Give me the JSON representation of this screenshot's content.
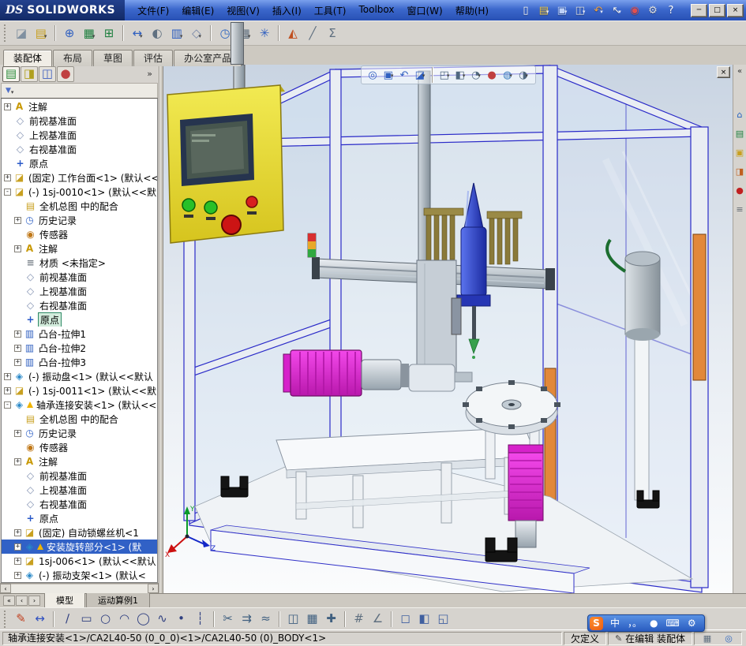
{
  "ui": {
    "dropdown_glyph": "▾"
  },
  "app": {
    "title_prefix": "DS",
    "title": "SOLIDWORKS"
  },
  "menubar": {
    "items": [
      "文件(F)",
      "编辑(E)",
      "视图(V)",
      "插入(I)",
      "工具(T)",
      "Toolbox",
      "窗口(W)",
      "帮助(H)"
    ]
  },
  "titlebar_tools": [
    {
      "name": "new-document-icon",
      "glyph": "▯",
      "color": "#f8f8f8"
    },
    {
      "name": "open-icon",
      "glyph": "▤",
      "color": "#f0c840",
      "dd": 1
    },
    {
      "name": "save-icon",
      "glyph": "▣",
      "color": "#bcd0f8",
      "dd": 1
    },
    {
      "name": "print-icon",
      "glyph": "◫",
      "color": "#d8dce0",
      "dd": 1
    },
    {
      "name": "undo-icon",
      "glyph": "↶",
      "color": "#f0a040",
      "dd": 1
    },
    {
      "name": "select-icon",
      "glyph": "↖",
      "color": "#f0f0f0",
      "dd": 1
    },
    {
      "name": "rebuild-icon",
      "glyph": "◉",
      "color": "#e05050"
    },
    {
      "name": "options-icon",
      "glyph": "⚙",
      "color": "#e0e0e0"
    },
    {
      "name": "help-icon",
      "glyph": "?",
      "color": "#ffffff"
    }
  ],
  "window_controls": [
    {
      "name": "minimize-button",
      "glyph": "─"
    },
    {
      "name": "maximize-button",
      "glyph": "□"
    },
    {
      "name": "close-button",
      "glyph": "×"
    }
  ],
  "toolbar2": {
    "items": [
      {
        "name": "edit-component-icon",
        "glyph": "◪",
        "color": "#8090a0"
      },
      {
        "name": "insert-components-icon",
        "glyph": "▤",
        "color": "#c8a020",
        "dd": 1
      },
      {
        "sep": 1
      },
      {
        "name": "mate-icon",
        "glyph": "⊕",
        "color": "#3060c0"
      },
      {
        "name": "linear-component-pattern-icon",
        "glyph": "▦",
        "color": "#208040",
        "dd": 1
      },
      {
        "name": "smart-fasteners-icon",
        "glyph": "⊞",
        "color": "#208040"
      },
      {
        "sep": 1
      },
      {
        "name": "move-component-icon",
        "glyph": "↔",
        "color": "#3060c0",
        "dd": 1
      },
      {
        "name": "show-hidden-components-icon",
        "glyph": "◐",
        "color": "#607080"
      },
      {
        "name": "assembly-features-icon",
        "glyph": "▥",
        "color": "#3060c0",
        "dd": 1
      },
      {
        "name": "reference-geometry-icon",
        "glyph": "◇",
        "color": "#7888a8",
        "dd": 1
      },
      {
        "sep": 1
      },
      {
        "name": "new-motion-study-icon",
        "glyph": "◷",
        "color": "#3068c0"
      },
      {
        "name": "bill-of-materials-icon",
        "glyph": "▦",
        "color": "#607080",
        "dd": 1
      },
      {
        "name": "exploded-view-icon",
        "glyph": "✳",
        "color": "#3060c0"
      },
      {
        "sep": 1
      },
      {
        "name": "interference-detection-icon",
        "glyph": "◭",
        "color": "#c05020"
      },
      {
        "name": "measure-icon",
        "glyph": "╱",
        "color": "#607080"
      },
      {
        "name": "mass-properties-icon",
        "glyph": "Σ",
        "color": "#607080"
      }
    ]
  },
  "command_tabs": {
    "items": [
      "装配体",
      "布局",
      "草图",
      "评估",
      "办公室产品"
    ],
    "active": 0
  },
  "feature_panel": {
    "tabs": [
      {
        "name": "featuremanager-tree-tab",
        "glyph": "▤",
        "color": "#2a8a3a"
      },
      {
        "name": "propertymanager-tab",
        "glyph": "◨",
        "color": "#b0a020"
      },
      {
        "name": "configurationmanager-tab",
        "glyph": "◫",
        "color": "#4060c0"
      },
      {
        "name": "displaymanager-tab",
        "glyph": "●",
        "color": "#c04040"
      }
    ],
    "overflow": "»",
    "filter_glyph": "▼",
    "hscroll_left": "‹",
    "hscroll_right": "›"
  },
  "tree": {
    "icon_defs": {
      "ann": {
        "glyph": "A",
        "color": "#c89800"
      },
      "plane": {
        "glyph": "◇",
        "color": "#8090b0"
      },
      "origin": {
        "glyph": "+",
        "color": "#2858c8"
      },
      "part": {
        "glyph": "◪",
        "color": "#c8a020"
      },
      "asm": {
        "glyph": "◈",
        "color": "#2888c8"
      },
      "mates": {
        "glyph": "▤",
        "color": "#c8a020"
      },
      "history": {
        "glyph": "◷",
        "color": "#3868c8"
      },
      "sensors": {
        "glyph": "◉",
        "color": "#c07818"
      },
      "material": {
        "glyph": "≡",
        "color": "#788088"
      },
      "extrude": {
        "glyph": "▥",
        "color": "#3060c0"
      }
    },
    "items": [
      {
        "i": 0,
        "e": "+",
        "ic": "ann",
        "t": "注解"
      },
      {
        "i": 0,
        "ic": "plane",
        "t": "前视基准面"
      },
      {
        "i": 0,
        "ic": "plane",
        "t": "上视基准面"
      },
      {
        "i": 0,
        "ic": "plane",
        "t": "右视基准面"
      },
      {
        "i": 0,
        "ic": "origin",
        "t": "原点"
      },
      {
        "i": 0,
        "e": "+",
        "ic": "part",
        "t": "(固定) 工作台面<1> (默认<<"
      },
      {
        "i": 0,
        "e": "-",
        "ic": "part",
        "t": "(-) 1sj-0010<1> (默认<<默"
      },
      {
        "i": 1,
        "ic": "mates",
        "t": "全机总图 中的配合"
      },
      {
        "i": 1,
        "e": "+",
        "ic": "history",
        "t": "历史记录"
      },
      {
        "i": 1,
        "ic": "sensors",
        "t": "传感器"
      },
      {
        "i": 1,
        "e": "+",
        "ic": "ann",
        "t": "注解"
      },
      {
        "i": 1,
        "ic": "material",
        "t": "材质 <未指定>"
      },
      {
        "i": 1,
        "ic": "plane",
        "t": "前视基准面"
      },
      {
        "i": 1,
        "ic": "plane",
        "t": "上视基准面"
      },
      {
        "i": 1,
        "ic": "plane",
        "t": "右视基准面"
      },
      {
        "i": 1,
        "ic": "origin",
        "t": "原点",
        "box": 1
      },
      {
        "i": 1,
        "e": "+",
        "ic": "extrude",
        "t": "凸台-拉伸1"
      },
      {
        "i": 1,
        "e": "+",
        "ic": "extrude",
        "t": "凸台-拉伸2"
      },
      {
        "i": 1,
        "e": "+",
        "ic": "extrude",
        "t": "凸台-拉伸3"
      },
      {
        "i": 0,
        "e": "+",
        "ic": "asm",
        "t": "(-) 振动盘<1> (默认<<默认"
      },
      {
        "i": 0,
        "e": "+",
        "ic": "part",
        "t": "(-) 1sj-0011<1> (默认<<默"
      },
      {
        "i": 0,
        "e": "-",
        "ic": "asm",
        "w": 1,
        "t": "轴承连接安装<1> (默认<<"
      },
      {
        "i": 1,
        "ic": "mates",
        "t": "全机总图 中的配合"
      },
      {
        "i": 1,
        "e": "+",
        "ic": "history",
        "t": "历史记录"
      },
      {
        "i": 1,
        "ic": "sensors",
        "t": "传感器"
      },
      {
        "i": 1,
        "e": "+",
        "ic": "ann",
        "t": "注解"
      },
      {
        "i": 1,
        "ic": "plane",
        "t": "前视基准面"
      },
      {
        "i": 1,
        "ic": "plane",
        "t": "上视基准面"
      },
      {
        "i": 1,
        "ic": "plane",
        "t": "右视基准面"
      },
      {
        "i": 1,
        "ic": "origin",
        "t": "原点"
      },
      {
        "i": 1,
        "e": "+",
        "ic": "part",
        "t": "(固定) 自动锁螺丝机<1"
      },
      {
        "i": 1,
        "e": "+",
        "ic": "asm",
        "w": 1,
        "sel": 1,
        "t": "安装旋转部分<1> (默"
      },
      {
        "i": 1,
        "e": "+",
        "ic": "part",
        "t": "1sj-006<1> (默认<<默认"
      },
      {
        "i": 1,
        "e": "+",
        "ic": "asm",
        "t": "(-) 振动支架<1> (默认<"
      }
    ]
  },
  "viewport": {
    "close_glyph": "×",
    "triad": {
      "x": "X",
      "y": "Y",
      "z": "Z"
    },
    "headsup": [
      {
        "name": "zoom-to-fit-icon",
        "glyph": "◎",
        "color": "#3060c0"
      },
      {
        "name": "zoom-to-area-icon",
        "glyph": "▣",
        "color": "#3060c0",
        "dd": 1
      },
      {
        "name": "previous-view-icon",
        "glyph": "↶",
        "color": "#3060c0"
      },
      {
        "name": "section-view-icon",
        "glyph": "◪",
        "color": "#3060c0",
        "dd": 1
      },
      {
        "sep": 1
      },
      {
        "name": "view-orientation-icon",
        "glyph": "◰",
        "color": "#506880",
        "dd": 1
      },
      {
        "name": "display-style-icon",
        "glyph": "◧",
        "color": "#506880",
        "dd": 1
      },
      {
        "name": "hide-show-items-icon",
        "glyph": "◔",
        "color": "#506880",
        "dd": 1
      },
      {
        "name": "edit-appearance-icon",
        "glyph": "●",
        "color": "#c04040"
      },
      {
        "name": "apply-scene-icon",
        "glyph": "◍",
        "color": "#4080c0",
        "dd": 1
      },
      {
        "name": "view-settings-icon",
        "glyph": "◑",
        "color": "#506880",
        "dd": 1
      }
    ]
  },
  "taskpane": {
    "collapse": "«",
    "icons": [
      {
        "name": "solidworks-resources-icon",
        "glyph": "⌂",
        "color": "#2060c0"
      },
      {
        "name": "design-library-icon",
        "glyph": "▤",
        "color": "#208040"
      },
      {
        "name": "file-explorer-icon",
        "glyph": "▣",
        "color": "#c8a020"
      },
      {
        "name": "view-palette-icon",
        "glyph": "◨",
        "color": "#c06020"
      },
      {
        "name": "appearances-icon",
        "glyph": "●",
        "color": "#c02020"
      },
      {
        "name": "custom-properties-icon",
        "glyph": "≡",
        "color": "#606870"
      }
    ]
  },
  "model_tabs": {
    "nav": [
      {
        "name": "model-tab-scroll-first-icon",
        "glyph": "«"
      },
      {
        "name": "model-tab-scroll-left-icon",
        "glyph": "‹"
      },
      {
        "name": "model-tab-scroll-right-icon",
        "glyph": "›"
      }
    ],
    "tabs": [
      "模型",
      "运动算例1"
    ],
    "active": 0
  },
  "sketchbar": {
    "items": [
      {
        "name": "sketch-icon",
        "glyph": "✎",
        "color": "#c04020"
      },
      {
        "name": "smart-dimension-icon",
        "glyph": "↔",
        "color": "#3050c0"
      },
      {
        "sep": 1
      },
      {
        "name": "line-icon",
        "glyph": "∕",
        "color": "#304080"
      },
      {
        "name": "rectangle-icon",
        "glyph": "▭",
        "color": "#304080"
      },
      {
        "name": "circle-icon",
        "glyph": "○",
        "color": "#304080"
      },
      {
        "name": "arc-icon",
        "glyph": "◠",
        "color": "#304080"
      },
      {
        "name": "ellipse-icon",
        "glyph": "◯",
        "color": "#304080"
      },
      {
        "name": "spline-icon",
        "glyph": "∿",
        "color": "#304080"
      },
      {
        "name": "point-icon",
        "glyph": "•",
        "color": "#304080"
      },
      {
        "name": "centerline-icon",
        "glyph": "┆",
        "color": "#304080"
      },
      {
        "sep": 1
      },
      {
        "name": "trim-entities-icon",
        "glyph": "✂",
        "color": "#406080"
      },
      {
        "name": "convert-entities-icon",
        "glyph": "⇉",
        "color": "#406080"
      },
      {
        "name": "offset-entities-icon",
        "glyph": "≈",
        "color": "#406080"
      },
      {
        "sep": 1
      },
      {
        "name": "mirror-entities-icon",
        "glyph": "◫",
        "color": "#406080"
      },
      {
        "name": "linear-sketch-pattern-icon",
        "glyph": "▦",
        "color": "#406080"
      },
      {
        "name": "move-entities-icon",
        "glyph": "✚",
        "color": "#406080"
      },
      {
        "sep": 1
      },
      {
        "name": "grid-settings-icon",
        "glyph": "#",
        "color": "#607080"
      },
      {
        "name": "snap-icon",
        "glyph": "∠",
        "color": "#607080"
      },
      {
        "sep": 1
      },
      {
        "name": "single-viewport-icon",
        "glyph": "◻",
        "color": "#4060a0"
      },
      {
        "name": "two-viewport-icon",
        "glyph": "◧",
        "color": "#4060a0"
      },
      {
        "name": "four-viewport-icon",
        "glyph": "◱",
        "color": "#4060a0"
      }
    ]
  },
  "statusbar": {
    "path": "轴承连接安装<1>/CA2L40-50 (0_0_0)<1>/CA2L40-50 (0)_BODY<1>",
    "defined": "欠定义",
    "editing": "在编辑 装配体",
    "edit_icon": "✎",
    "icons": [
      {
        "name": "selection-filter-status-icon",
        "glyph": "▦",
        "color": "#607080"
      },
      {
        "name": "quick-tips-icon",
        "glyph": "◎",
        "color": "#3068c0"
      }
    ]
  },
  "ime": {
    "logo": "S",
    "items": [
      {
        "name": "ime-mode-chinese",
        "glyph": "中"
      },
      {
        "name": "ime-punctuation-icon",
        "glyph": "，。"
      },
      {
        "name": "ime-fullwidth-icon",
        "glyph": "●"
      },
      {
        "name": "ime-keyboard-icon",
        "glyph": "⌨"
      },
      {
        "name": "ime-settings-icon",
        "glyph": "⚙"
      }
    ]
  }
}
